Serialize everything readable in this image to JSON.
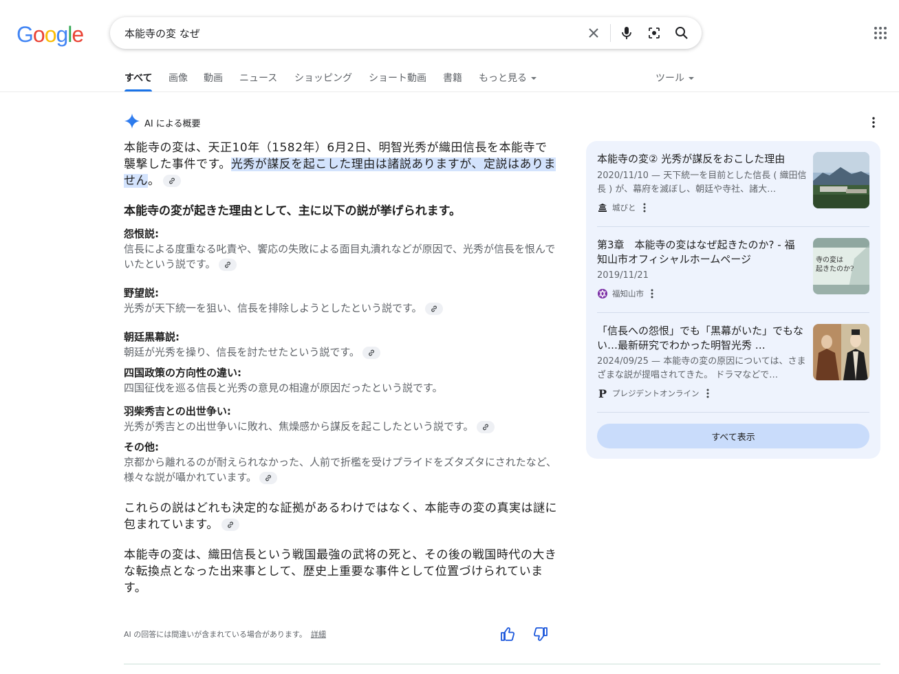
{
  "logo": {
    "letters": [
      "G",
      "o",
      "o",
      "g",
      "l",
      "e"
    ],
    "colors": [
      "#4285f4",
      "#ea4335",
      "#fbbc05",
      "#4285f4",
      "#34a853",
      "#ea4335"
    ]
  },
  "search": {
    "query": "本能寺の変 なぜ"
  },
  "icons": {
    "clear": "close-icon",
    "voice": "microphone-icon",
    "lens": "camera-lens-icon",
    "search": "search-icon",
    "apps": "apps-grid-icon"
  },
  "tabs": [
    {
      "label": "すべて",
      "active": true
    },
    {
      "label": "画像"
    },
    {
      "label": "動画"
    },
    {
      "label": "ニュース"
    },
    {
      "label": "ショッピング"
    },
    {
      "label": "ショート動画"
    },
    {
      "label": "書籍"
    },
    {
      "label": "もっと見る"
    }
  ],
  "tools": {
    "label": "ツール"
  },
  "ai": {
    "heading": "AI による概要",
    "intro_plain": "本能寺の変は、天正10年（1582年）6月2日、明智光秀が織田信長を本能寺で襲撃した事件です。",
    "intro_highlight": "光秀が謀反を起こした理由は諸説ありますが、定説はありません",
    "intro_end": "。",
    "reasons_heading": "本能寺の変が起きた理由として、主に以下の説が挙げられます。",
    "theories": [
      {
        "title": "怨恨説:",
        "desc": "信長による度重なる叱責や、饗応の失敗による面目丸潰れなどが原因で、光秀が信長を恨んでいたという説です。"
      },
      {
        "title": "野望説:",
        "desc": "光秀が天下統一を狙い、信長を排除しようとしたという説です。"
      },
      {
        "title": "朝廷黒幕説:",
        "desc": "朝廷が光秀を操り、信長を討たせたという説です。"
      },
      {
        "title": "四国政策の方向性の違い:",
        "desc": "四国征伐を巡る信長と光秀の意見の相違が原因だったという説です。"
      },
      {
        "title": "羽柴秀吉との出世争い:",
        "desc": "光秀が秀吉との出世争いに敗れ、焦燥感から謀反を起こしたという説です。"
      },
      {
        "title": "その他:",
        "desc": "京都から離れるのが耐えられなかった、人前で折檻を受けプライドをズタズタにされたなど、様々な説が囁かれています。"
      }
    ],
    "conclusion1": "これらの説はどれも決定的な証拠があるわけではなく、本能寺の変の真実は謎に包まれています。",
    "conclusion2": "本能寺の変は、織田信長という戦国最強の武将の死と、その後の戦国時代の大きな転換点となった出来事として、歴史上重要な事件として位置づけられています。",
    "disclaimer": "AI の回答には間違いが含まれている場合があります。",
    "details_link": "詳細"
  },
  "sources": [
    {
      "title": "本能寺の変② 光秀が謀反をおこした理由",
      "snippet": "2020/11/10 — 天下統一を目前とした信長 ( 織田信長 ) が、幕府を滅ぼし、朝廷や寺社、諸大…",
      "source": "城びと"
    },
    {
      "title": "第3章　本能寺の変はなぜ起きたのか? - 福知山市オフィシャルホームページ",
      "snippet": "2019/11/21",
      "source": "福知山市",
      "thumb_text": "寺の変は\n起きたのか?"
    },
    {
      "title": "「信長への怨恨」でも「黒幕がいた」でもない…最新研究でわかった明智光秀 …",
      "snippet": "2024/09/25 — 本能寺の変の原因については、さまざまな説が提唱されてきた。 ドラマなどで…",
      "source": "プレジデントオンライン",
      "source_letter": "P"
    }
  ],
  "show_all": "すべて表示",
  "colors": {
    "accent": "#1a73e8",
    "highlight": "#d3e3fd",
    "panel": "#eef3fd",
    "button": "#c9dcfb"
  }
}
